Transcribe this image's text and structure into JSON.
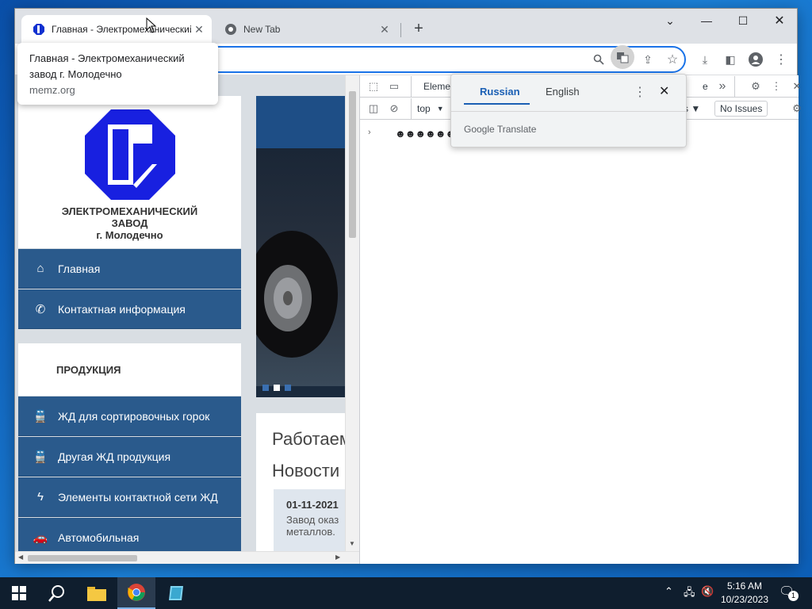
{
  "browser": {
    "tabs": [
      {
        "title": "Главная - Электромеханический",
        "active": true
      },
      {
        "title": "New Tab",
        "active": false
      }
    ],
    "tooltip": {
      "title": "Главная - Электромеханический завод г. Молодечно",
      "url": "memz.org"
    }
  },
  "translate": {
    "source_lang": "Russian",
    "target_lang": "English",
    "brand": "Google Translate"
  },
  "page": {
    "logo_line1": "ЭЛЕКТРОМЕХАНИЧЕСКИЙ",
    "logo_line2": "ЗАВОД",
    "logo_line3": "г. Молодечно",
    "menu": [
      {
        "label": "Главная",
        "icon": "home-icon"
      },
      {
        "label": "Контактная информация",
        "icon": "phone-icon"
      }
    ],
    "products_title": "ПРОДУКЦИЯ",
    "products": [
      {
        "label": "ЖД для сортировочных горок",
        "icon": "train-icon"
      },
      {
        "label": "Другая ЖД продукция",
        "icon": "train-icon"
      },
      {
        "label": "Элементы контактной сети ЖД",
        "icon": "lightning-icon"
      },
      {
        "label": "Автомобильная",
        "icon": "car-icon"
      }
    ],
    "news_heading1": "Работаем",
    "news_heading2": "Новости",
    "news_date": "01-11-2021",
    "news_text1": "Завод оказ",
    "news_text2": "металлов."
  },
  "devtools": {
    "tab_elements": "Elemen",
    "context": "top",
    "issues": "No Issues",
    "console_line": "☻☻☻☻☻☻☻☻"
  },
  "taskbar": {
    "time": "5:16 AM",
    "date": "10/23/2023",
    "notification_count": "1"
  }
}
